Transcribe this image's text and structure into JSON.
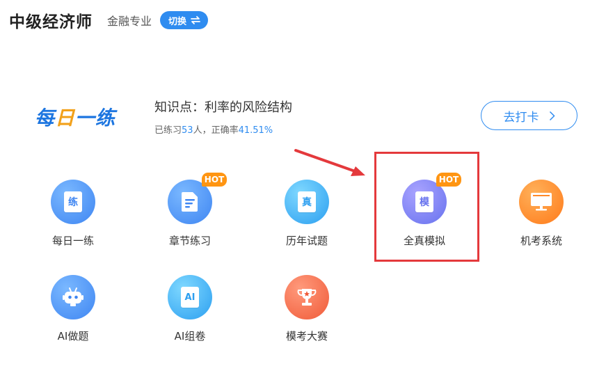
{
  "header": {
    "app_title": "中级经济师",
    "subject": "金融专业",
    "switch_label": "切换"
  },
  "daily": {
    "logo_chars": [
      "每",
      "日",
      "一",
      "练"
    ],
    "knowledge_prefix": "知识点：",
    "knowledge_topic": "利率的风险结构",
    "stats_prefix": "已练习",
    "practice_count": "53",
    "stats_mid": "人，正确率",
    "accuracy": "41.51%",
    "checkin_label": "去打卡"
  },
  "tiles": [
    {
      "label": "每日一练",
      "icon_text": "练",
      "hot": ""
    },
    {
      "label": "章节练习",
      "icon_text": "",
      "hot": "HOT"
    },
    {
      "label": "历年试题",
      "icon_text": "真",
      "hot": ""
    },
    {
      "label": "全真模拟",
      "icon_text": "模",
      "hot": "HOT"
    },
    {
      "label": "机考系统",
      "icon_text": "",
      "hot": ""
    },
    {
      "label": "AI做题",
      "icon_text": "",
      "hot": ""
    },
    {
      "label": "AI组卷",
      "icon_text": "AI",
      "hot": ""
    },
    {
      "label": "模考大赛",
      "icon_text": "",
      "hot": ""
    }
  ],
  "colors": {
    "accent": "#2f8cf0",
    "hot_badge": "#ff9512",
    "annotation_red": "#e4393c"
  }
}
